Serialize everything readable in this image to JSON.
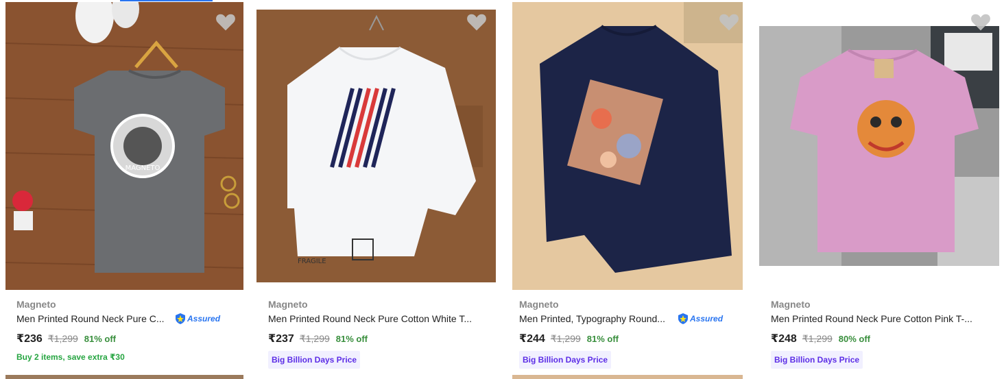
{
  "products": [
    {
      "brand": "Magneto",
      "title": "Men Printed Round Neck Pure C...",
      "assured": "Assured",
      "price": "₹236",
      "mrp": "₹1,299",
      "discount": "81% off",
      "offer": "Buy 2 items, save extra ₹30",
      "image_icon": "tshirt-grey-photo"
    },
    {
      "brand": "Magneto",
      "title": "Men Printed Round Neck Pure Cotton White T...",
      "price": "₹237",
      "mrp": "₹1,299",
      "discount": "81% off",
      "badge": "Big Billion Days Price",
      "image_icon": "tshirt-white-photo"
    },
    {
      "brand": "Magneto",
      "title": "Men Printed, Typography Round...",
      "assured": "Assured",
      "price": "₹244",
      "mrp": "₹1,299",
      "discount": "81% off",
      "badge": "Big Billion Days Price",
      "image_icon": "tshirt-navy-photo"
    },
    {
      "brand": "Magneto",
      "title": "Men Printed Round Neck Pure Cotton Pink T-...",
      "price": "₹248",
      "mrp": "₹1,299",
      "discount": "80% off",
      "badge": "Big Billion Days Price",
      "image_icon": "tshirt-pink-photo"
    }
  ],
  "icons": {
    "wishlist": "heart-icon",
    "assured": "flipkart-assured-shield-icon"
  },
  "colors": {
    "accent": "#2874f0",
    "discount": "#388e3c",
    "offer": "#26a541",
    "badge_text": "#5c2de6",
    "badge_bg": "#f1f0ff"
  }
}
